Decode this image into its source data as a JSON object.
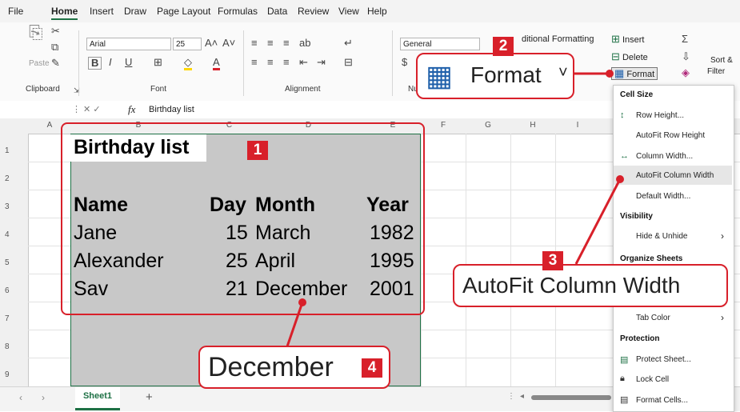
{
  "ribbon_tabs": [
    "File",
    "Home",
    "Insert",
    "Draw",
    "Page Layout",
    "Formulas",
    "Data",
    "Review",
    "View",
    "Help"
  ],
  "ribbon": {
    "font_name": "Arial",
    "font_size": "25",
    "number_format": "General",
    "clipboard_label": "Clipboard",
    "paste_label": "Paste",
    "font_label": "Font",
    "alignment_label": "Alignment",
    "number_label": "Nu",
    "conditional": "ditional Formatting",
    "insert": "Insert",
    "delete": "Delete",
    "format": "Format",
    "sort": "Sort &",
    "filter": "Filter"
  },
  "formula_bar": {
    "fx": "fx",
    "content": "Birthday list"
  },
  "columns": [
    "A",
    "B",
    "C",
    "D",
    "E",
    "F",
    "G",
    "H",
    "I"
  ],
  "rows": [
    "1",
    "2",
    "3",
    "4",
    "5",
    "6",
    "7",
    "8",
    "9"
  ],
  "cells": {
    "title": "Birthday list",
    "header": [
      "Name",
      "Day",
      "Month",
      "Year"
    ],
    "data": [
      [
        "Jane",
        "15",
        "March",
        "1982"
      ],
      [
        "Alexander",
        "25",
        "April",
        "1995"
      ],
      [
        "Sav",
        "21",
        "December",
        "2001"
      ]
    ]
  },
  "sheet_tab": "Sheet1",
  "format_menu": {
    "cell_size": "Cell Size",
    "row_height": "Row Height...",
    "autofit_row": "AutoFit Row Height",
    "column_width": "Column Width...",
    "autofit_col": "AutoFit Column Width",
    "default_width": "Default Width...",
    "visibility": "Visibility",
    "hide_unhide": "Hide & Unhide",
    "organize": "Organize Sheets",
    "tab_color": "Tab Color",
    "protection": "Protection",
    "protect_sheet": "Protect Sheet...",
    "lock_cell": "Lock Cell",
    "format_cells": "Format Cells..."
  },
  "callouts": {
    "badge1": "1",
    "badge2": "2",
    "badge3": "3",
    "badge4": "4",
    "format_big": "Format",
    "autofit_big": "AutoFit Column Width",
    "december_big": "December"
  },
  "colors": {
    "accent": "#d8202a",
    "excel_green": "#1e7145",
    "selection": "#c8c8c8"
  }
}
